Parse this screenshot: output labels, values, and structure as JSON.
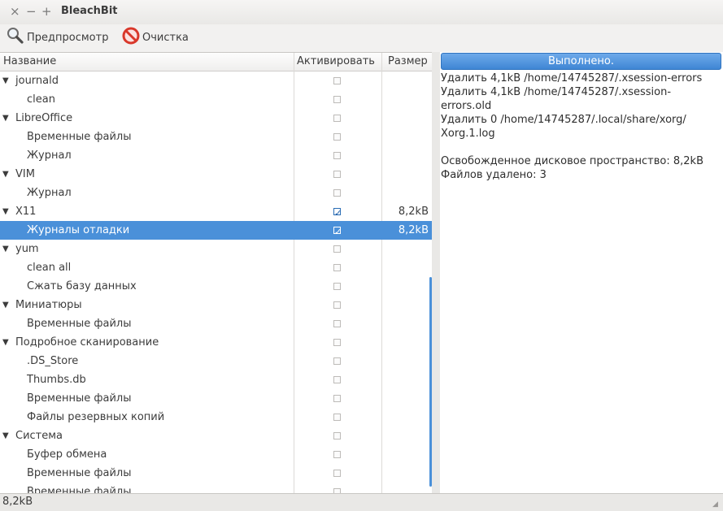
{
  "window": {
    "title": "BleachBit",
    "close_glyph": "×",
    "minimize_glyph": "−",
    "maximize_glyph": "+"
  },
  "toolbar": {
    "preview_label": "Предпросмотр",
    "preview_icon": "magnifier-icon",
    "clean_label": "Очистка",
    "clean_icon": "no-entry-icon"
  },
  "table": {
    "headers": {
      "name": "Название",
      "activate": "Активировать",
      "size": "Размер"
    },
    "rows": [
      {
        "label": "journald",
        "level": 0,
        "expanded": true,
        "checked": false,
        "size": ""
      },
      {
        "label": "clean",
        "level": 1,
        "checked": false,
        "size": ""
      },
      {
        "label": "LibreOffice",
        "level": 0,
        "expanded": true,
        "checked": false,
        "size": ""
      },
      {
        "label": "Временные файлы",
        "level": 1,
        "checked": false,
        "size": ""
      },
      {
        "label": "Журнал",
        "level": 1,
        "checked": false,
        "size": ""
      },
      {
        "label": "VIM",
        "level": 0,
        "expanded": true,
        "checked": false,
        "size": ""
      },
      {
        "label": "Журнал",
        "level": 1,
        "checked": false,
        "size": ""
      },
      {
        "label": "X11",
        "level": 0,
        "expanded": true,
        "checked": true,
        "size": "8,2kB"
      },
      {
        "label": "Журналы отладки",
        "level": 1,
        "checked": true,
        "size": "8,2kB",
        "selected": true
      },
      {
        "label": "yum",
        "level": 0,
        "expanded": true,
        "checked": false,
        "size": ""
      },
      {
        "label": "clean all",
        "level": 1,
        "checked": false,
        "size": ""
      },
      {
        "label": "Сжать базу данных",
        "level": 1,
        "checked": false,
        "size": ""
      },
      {
        "label": "Миниатюры",
        "level": 0,
        "expanded": true,
        "checked": false,
        "size": ""
      },
      {
        "label": "Временные файлы",
        "level": 1,
        "checked": false,
        "size": ""
      },
      {
        "label": "Подробное сканирование",
        "level": 0,
        "expanded": true,
        "checked": false,
        "size": ""
      },
      {
        "label": ".DS_Store",
        "level": 1,
        "checked": false,
        "size": ""
      },
      {
        "label": "Thumbs.db",
        "level": 1,
        "checked": false,
        "size": ""
      },
      {
        "label": "Временные файлы",
        "level": 1,
        "checked": false,
        "size": ""
      },
      {
        "label": "Файлы резервных копий",
        "level": 1,
        "checked": false,
        "size": ""
      },
      {
        "label": "Система",
        "level": 0,
        "expanded": true,
        "checked": false,
        "size": ""
      },
      {
        "label": "Буфер обмена",
        "level": 1,
        "checked": false,
        "size": ""
      },
      {
        "label": "Временные файлы",
        "level": 1,
        "checked": false,
        "size": ""
      },
      {
        "label": "Временные файлы",
        "level": 1,
        "checked": false,
        "size": ""
      }
    ]
  },
  "progress": {
    "label": "Выполнено.",
    "fraction": 1.0
  },
  "log": {
    "lines": [
      "Удалить 4,1kB /home/14745287/.xsession-errors",
      "Удалить 4,1kB /home/14745287/.xsession-\nerrors.old",
      "Удалить 0 /home/14745287/.local/share/xorg/\nXorg.1.log",
      "",
      "Освобожденное дисковое пространство: 8,2kB",
      "Файлов удалено: 3"
    ]
  },
  "status": {
    "text": "8,2kB"
  },
  "colors": {
    "selection": "#4a90d9",
    "progress": "#4a90d9",
    "clean_icon": "#d9382b"
  }
}
